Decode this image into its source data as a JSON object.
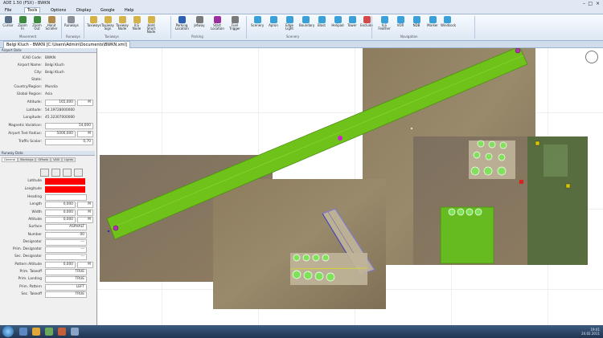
{
  "window": {
    "title": "ADE 1.50 (FSX) - BWKN"
  },
  "menu": {
    "items": [
      "File",
      "Tools",
      "Options",
      "Display",
      "Google",
      "Help"
    ]
  },
  "ribbon": {
    "buttons": [
      {
        "label": "Cursor",
        "color": "#5a6e88"
      },
      {
        "label": "Zoom In",
        "color": "#3e8a3e"
      },
      {
        "label": "Zoom Out",
        "color": "#3e8a3e"
      },
      {
        "label": "Hand Scroller",
        "color": "#b08a4a"
      },
      {
        "label": "Runways",
        "color": "#8a8f9a"
      },
      {
        "label": "Taxiways",
        "color": "#d4b24a"
      },
      {
        "label": "Taxiway Sign",
        "color": "#d4b24a"
      },
      {
        "label": "Taxiway Node",
        "color": "#d4b24a"
      },
      {
        "label": "ILS Node",
        "color": "#d4b24a"
      },
      {
        "label": "Hold Short Node",
        "color": "#d4b24a"
      },
      {
        "label": "Parking Location",
        "color": "#2d5fb5"
      },
      {
        "label": "Jetway",
        "color": "#7a7a7a"
      },
      {
        "label": "Start Location",
        "color": "#9b2fa0"
      },
      {
        "label": "Fuel Trigger",
        "color": "#7a7a7a"
      },
      {
        "label": "Scenery",
        "color": "#3aa0d8"
      },
      {
        "label": "Apron",
        "color": "#3aa0d8"
      },
      {
        "label": "Edge Light",
        "color": "#3aa0d8"
      },
      {
        "label": "Boundary",
        "color": "#3aa0d8"
      },
      {
        "label": "Blast",
        "color": "#3aa0d8"
      },
      {
        "label": "Helipad",
        "color": "#3aa0d8"
      },
      {
        "label": "Tower",
        "color": "#3aa0d8"
      },
      {
        "label": "Exclude",
        "color": "#d24a4a"
      },
      {
        "label": "ILS Feather",
        "color": "#3aa0d8"
      },
      {
        "label": "VOR",
        "color": "#3aa0d8"
      },
      {
        "label": "NDB",
        "color": "#3aa0d8"
      },
      {
        "label": "Marker",
        "color": "#3aa0d8"
      },
      {
        "label": "Windsock",
        "color": "#3aa0d8"
      }
    ],
    "groups": [
      "Movement",
      "Runways",
      "Taxiways",
      "Parking",
      "Scenery",
      "Navigation"
    ]
  },
  "doc_tab": {
    "label": "Belgi Kluch - BWKN [C:\\Users\\Admin\\Documents\\BWKN.xml]"
  },
  "airport_panel": {
    "header": "Airport Data",
    "icao_label": "ICAO Code:",
    "icao_value": "BWKN",
    "name_label": "Airport Name:",
    "name_value": "Belgi Kluch",
    "city_label": "City:",
    "city_value": "Belgi Kluch",
    "state_label": "State:",
    "state_value": "",
    "country_label": "Country/Region:",
    "country_value": "Mundia",
    "global_label": "Global Region:",
    "global_value": "Asia",
    "altitude_label": "Altitude:",
    "altitude_value": "165,000",
    "altitude_unit": "M",
    "lat_label": "Latitude:",
    "lat_value": "54.19728000000",
    "lon_label": "Longitude:",
    "lon_value": "45.32307000000",
    "magvar_label": "Magnetic Variation:",
    "magvar_value": "54,000",
    "radius_label": "Airport Test Radius:",
    "radius_value": "5000,000",
    "radius_unit": "M",
    "traffic_label": "Traffic Scalar:",
    "traffic_value": "0,70"
  },
  "runway_panel": {
    "header": "Runway Data",
    "tabs": [
      "General",
      "Markings",
      "Offsets",
      "VASI",
      "Lights"
    ],
    "fields": [
      {
        "label": "Latitude",
        "value": "",
        "type": "red"
      },
      {
        "label": "Longitude",
        "value": "",
        "type": "red"
      },
      {
        "label": "Heading",
        "value": "",
        "type": "text"
      },
      {
        "label": "Length",
        "value": "0,000",
        "unit": "M"
      },
      {
        "label": "Width",
        "value": "0,000",
        "unit": "M"
      },
      {
        "label": "Altitude",
        "value": "0,000",
        "unit": "M"
      },
      {
        "label": "Surface",
        "value": "ASPHALT"
      },
      {
        "label": "Number",
        "value": "00"
      },
      {
        "label": "Designator",
        "value": "---"
      },
      {
        "label": "Prim. Designator",
        "value": "---"
      },
      {
        "label": "Sec. Designator",
        "value": "---"
      },
      {
        "label": "Pattern Altitude",
        "value": "0,000",
        "unit": "M"
      },
      {
        "label": "Prim. Takeoff",
        "value": "TRUE"
      },
      {
        "label": "Prim. Landing",
        "value": "TRUE"
      },
      {
        "label": "Prim. Pattern",
        "value": "LEFT"
      },
      {
        "label": "Sec. Takeoff",
        "value": "TRUE"
      }
    ]
  },
  "map": {
    "runway_color": "#6fc21a",
    "apron_color": "#66bb20"
  },
  "taskbar": {
    "time": "19:41",
    "date": "24.02.2011"
  }
}
